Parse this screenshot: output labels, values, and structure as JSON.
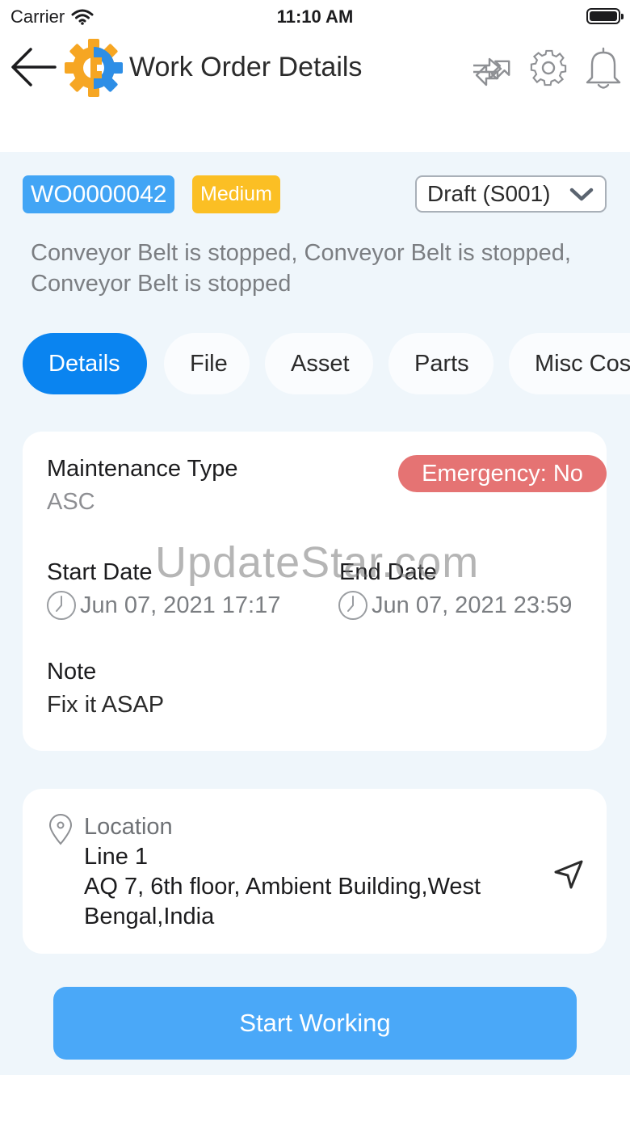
{
  "status_bar": {
    "carrier": "Carrier",
    "time": "11:10 AM"
  },
  "nav": {
    "title": "Work Order Details",
    "icons": {
      "back": "arrow-left-icon",
      "logo": "gear-logo-icon",
      "transfer": "transfer-arrows-icon",
      "settings": "gear-icon",
      "notifications": "bell-icon"
    }
  },
  "work_order": {
    "id": "WO0000042",
    "priority": "Medium",
    "status": "Draft (S001)",
    "description": "Conveyor Belt is stopped, Conveyor Belt is stopped,  Conveyor Belt is stopped"
  },
  "tabs": [
    {
      "label": "Details",
      "active": true
    },
    {
      "label": "File",
      "active": false
    },
    {
      "label": "Asset",
      "active": false
    },
    {
      "label": "Parts",
      "active": false
    },
    {
      "label": "Misc Cost",
      "active": false
    }
  ],
  "details": {
    "maintenance_type_label": "Maintenance Type",
    "maintenance_type_value": "ASC",
    "emergency": "Emergency: No",
    "start_date_label": "Start Date",
    "start_date_value": "Jun 07, 2021 17:17",
    "end_date_label": "End Date",
    "end_date_value": "Jun 07, 2021 23:59",
    "note_label": "Note",
    "note_value": "Fix it ASAP"
  },
  "location": {
    "label": "Location",
    "name": "Line 1",
    "address_line1": "AQ 7, 6th floor, Ambient Building,West",
    "address_line2": "Bengal,India"
  },
  "actions": {
    "start_working": "Start Working"
  },
  "watermark": "UpdateStar.com",
  "colors": {
    "accent": "#0a84f0",
    "badge_blue": "#42a5f5",
    "priority_medium": "#fbbf24",
    "emergency": "#e57373",
    "button": "#4aa8f8",
    "background": "#eff6fb"
  }
}
